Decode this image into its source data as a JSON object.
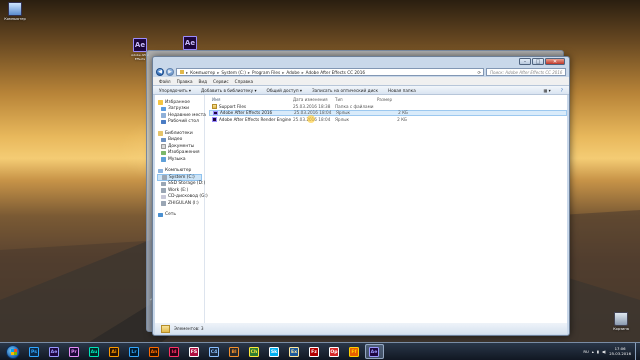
{
  "desktop": {
    "icons": [
      {
        "label": "Компьютер",
        "kind": "computer"
      },
      {
        "label": "Adobe After Effects",
        "kind": "ae"
      },
      {
        "label": "",
        "kind": "ae"
      },
      {
        "label": "Корзина",
        "kind": "recycle"
      }
    ]
  },
  "window": {
    "caption_buttons": [
      "–",
      "□",
      "✕"
    ],
    "breadcrumb": [
      "Компьютер",
      "System (C:)",
      "Program Files",
      "Adobe",
      "Adobe After Effects CC 2016"
    ],
    "search_placeholder": "Поиск: Adobe After Effects CC 2016",
    "menu": [
      "Файл",
      "Правка",
      "Вид",
      "Сервис",
      "Справка"
    ],
    "toolbar": [
      "Упорядочить ▾",
      "Добавить в библиотеку ▾",
      "Общий доступ ▾",
      "Записать на оптический диск",
      "Новая папка"
    ],
    "nav": {
      "favorites": {
        "title": "Избранное",
        "items": [
          "Загрузки",
          "Недавние места",
          "Рабочий стол"
        ]
      },
      "libraries": {
        "title": "Библиотеки",
        "items": [
          "Видео",
          "Документы",
          "Изображения",
          "Музыка"
        ]
      },
      "computer": {
        "title": "Компьютер",
        "items": [
          "System (C:)",
          "SSD Storage (D:)",
          "Work (E:)",
          "CD-дисковод (G:)",
          "ZHIGULAN (I:)"
        ]
      },
      "network": {
        "title": "Сеть"
      }
    },
    "columns": {
      "name": "Имя",
      "date": "Дата изменения",
      "type": "Тип",
      "size": "Размер"
    },
    "files": [
      {
        "name": "Support Files",
        "date": "25.03.2016 18:38",
        "type": "Папка с файлами",
        "size": "",
        "kind": "folder"
      },
      {
        "name": "Adobe After Effects 2016",
        "date": "25.03.2016 18:04",
        "type": "Ярлык",
        "size": "2 КБ",
        "kind": "ae"
      },
      {
        "name": "Adobe After Effects Render Engine",
        "date": "25.03.2016 18:04",
        "type": "Ярлык",
        "size": "2 КБ",
        "kind": "ae"
      }
    ],
    "status": "Элементов: 3"
  },
  "taskbar": {
    "apps": [
      {
        "name": "Ps",
        "color": "#0a2a4a",
        "fg": "#31a8ff"
      },
      {
        "name": "Ae",
        "color": "#1f0740",
        "fg": "#9999ff"
      },
      {
        "name": "Pr",
        "color": "#1c0938",
        "fg": "#e58ef8"
      },
      {
        "name": "Au",
        "color": "#002b26",
        "fg": "#00e4bb"
      },
      {
        "name": "Ai",
        "color": "#2a1400",
        "fg": "#ff9a00"
      },
      {
        "name": "Lr",
        "color": "#001a2e",
        "fg": "#31a8ff"
      },
      {
        "name": "An",
        "color": "#2a1200",
        "fg": "#ff6a00"
      },
      {
        "name": "Id",
        "color": "#2a0014",
        "fg": "#ff3366"
      },
      {
        "name": "FS",
        "color": "#b01040",
        "fg": "#ffffff"
      },
      {
        "name": "C4",
        "color": "#1a2a40",
        "fg": "#8ac0ff"
      },
      {
        "name": "Bl",
        "color": "#2a2a2a",
        "fg": "#f5922e"
      },
      {
        "name": "Ch",
        "color": "#2e7d32",
        "fg": "#ffeb3b"
      },
      {
        "name": "Sk",
        "color": "#00aff0",
        "fg": "#ffffff"
      },
      {
        "name": "Ex",
        "color": "#1e5a9a",
        "fg": "#ffe9a0"
      },
      {
        "name": "Fz",
        "color": "#b30000",
        "fg": "#ffffff"
      },
      {
        "name": "Op",
        "color": "#d62828",
        "fg": "#ffffff"
      },
      {
        "name": "Ff",
        "color": "#e66000",
        "fg": "#ffd100"
      },
      {
        "name": "Ae",
        "color": "#1f0740",
        "fg": "#9999ff"
      }
    ],
    "lang": "RU",
    "time": "17:06",
    "date": "25.03.2016"
  }
}
